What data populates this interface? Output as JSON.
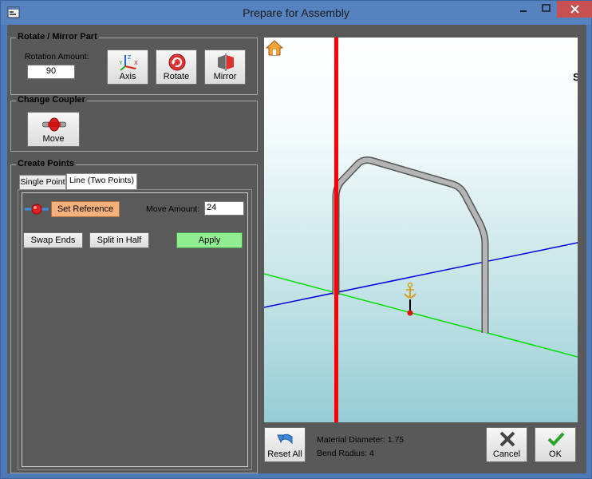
{
  "window": {
    "title": "Prepare for Assembly",
    "app_icon": "form-icon"
  },
  "rotate_mirror": {
    "group_title": "Rotate / Mirror Part",
    "rotation_label": "Rotation Amount:",
    "rotation_value": "90",
    "axis_label": "Axis",
    "rotate_label": "Rotate",
    "mirror_label": "Mirror"
  },
  "coupler": {
    "group_title": "Change Coupler",
    "move_label": "Move"
  },
  "create_points": {
    "group_title": "Create Points",
    "tabs": [
      "Single Point",
      "Line (Two Points)"
    ],
    "active_tab": 1,
    "set_reference_label": "Set Reference",
    "move_amount_label": "Move Amount:",
    "move_amount_value": "24",
    "swap_ends_label": "Swap Ends",
    "split_half_label": "Split in Half",
    "apply_label": "Apply"
  },
  "viewport": {
    "home_icon": "home-icon",
    "clipped_char": "S"
  },
  "footer": {
    "reset_all_label": "Reset All",
    "material_diameter": "Material Diameter: 1.75",
    "bend_radius": "Bend Radius: 4",
    "cancel_label": "Cancel",
    "ok_label": "OK"
  },
  "colors": {
    "titlebar": "#5683c0",
    "panel": "#595959",
    "set_reference_bg": "#f7b27c",
    "apply_bg": "#90ee90",
    "close_button": "#c75050",
    "axis_red": "#ff0000",
    "axis_green": "#00e000",
    "axis_blue": "#0000e0"
  }
}
